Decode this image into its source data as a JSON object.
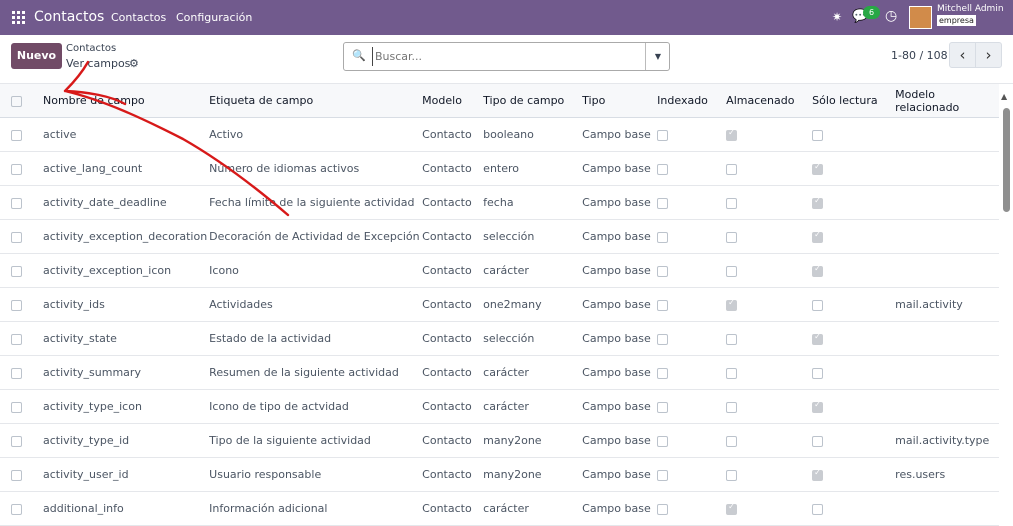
{
  "topbar": {
    "app": "Contactos",
    "menus": [
      "Contactos",
      "Configuración"
    ],
    "badge": "6",
    "user": "Mitchell Admin",
    "company": "empresa"
  },
  "control": {
    "new": "Nuevo",
    "breadcrumb": "Contactos",
    "view": "Ver campos",
    "placeholder": "Buscar...",
    "pager": "1-80 / 108"
  },
  "columns": [
    "Nombre de campo",
    "Etiqueta de campo",
    "Modelo",
    "Tipo de campo",
    "Tipo",
    "Indexado",
    "Almacenado",
    "Sólo lectura",
    "Modelo relacionado"
  ],
  "rows": [
    {
      "name": "active",
      "label": "Activo",
      "model": "Contacto",
      "ftype": "booleano",
      "type": "Campo base",
      "indexed": false,
      "stored": true,
      "readonly": false,
      "related": ""
    },
    {
      "name": "active_lang_count",
      "label": "Número de idiomas activos",
      "model": "Contacto",
      "ftype": "entero",
      "type": "Campo base",
      "indexed": false,
      "stored": false,
      "readonly": true,
      "related": ""
    },
    {
      "name": "activity_date_deadline",
      "label": "Fecha límite de la siguiente actividad",
      "model": "Contacto",
      "ftype": "fecha",
      "type": "Campo base",
      "indexed": false,
      "stored": false,
      "readonly": true,
      "related": ""
    },
    {
      "name": "activity_exception_decoration",
      "label": "Decoración de Actividad de Excepción",
      "model": "Contacto",
      "ftype": "selección",
      "type": "Campo base",
      "indexed": false,
      "stored": false,
      "readonly": true,
      "related": ""
    },
    {
      "name": "activity_exception_icon",
      "label": "Icono",
      "model": "Contacto",
      "ftype": "carácter",
      "type": "Campo base",
      "indexed": false,
      "stored": false,
      "readonly": true,
      "related": ""
    },
    {
      "name": "activity_ids",
      "label": "Actividades",
      "model": "Contacto",
      "ftype": "one2many",
      "type": "Campo base",
      "indexed": false,
      "stored": true,
      "readonly": false,
      "related": "mail.activity"
    },
    {
      "name": "activity_state",
      "label": "Estado de la actividad",
      "model": "Contacto",
      "ftype": "selección",
      "type": "Campo base",
      "indexed": false,
      "stored": false,
      "readonly": true,
      "related": ""
    },
    {
      "name": "activity_summary",
      "label": "Resumen de la siguiente actividad",
      "model": "Contacto",
      "ftype": "carácter",
      "type": "Campo base",
      "indexed": false,
      "stored": false,
      "readonly": false,
      "related": ""
    },
    {
      "name": "activity_type_icon",
      "label": "Icono de tipo de actvidad",
      "model": "Contacto",
      "ftype": "carácter",
      "type": "Campo base",
      "indexed": false,
      "stored": false,
      "readonly": true,
      "related": ""
    },
    {
      "name": "activity_type_id",
      "label": "Tipo de la siguiente actividad",
      "model": "Contacto",
      "ftype": "many2one",
      "type": "Campo base",
      "indexed": false,
      "stored": false,
      "readonly": false,
      "related": "mail.activity.type"
    },
    {
      "name": "activity_user_id",
      "label": "Usuario responsable",
      "model": "Contacto",
      "ftype": "many2one",
      "type": "Campo base",
      "indexed": false,
      "stored": false,
      "readonly": true,
      "related": "res.users"
    },
    {
      "name": "additional_info",
      "label": "Información adicional",
      "model": "Contacto",
      "ftype": "carácter",
      "type": "Campo base",
      "indexed": false,
      "stored": true,
      "readonly": false,
      "related": ""
    }
  ],
  "colors": {
    "topbar": "#715a8d",
    "new": "#714b67",
    "annotation": "#d71919"
  }
}
